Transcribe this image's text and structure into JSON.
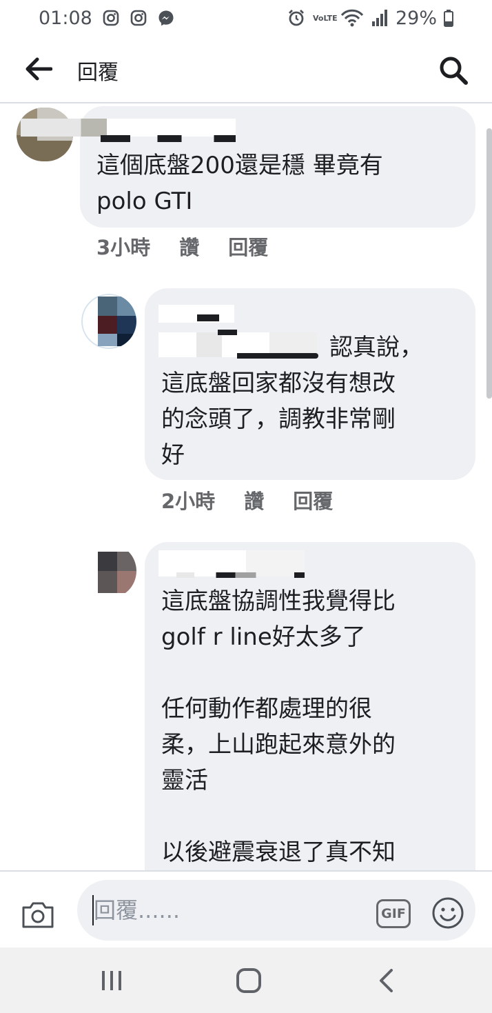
{
  "status_bar": {
    "time": "01:08",
    "network": "VoLTE",
    "battery": "29%"
  },
  "header": {
    "title": "回覆",
    "back_icon": "arrow-left-icon",
    "search_icon": "search-icon"
  },
  "comments": [
    {
      "text": "這個底盤200還是穩 畢竟有\npolo GTI",
      "time": "3小時",
      "like": "讚",
      "reply": "回覆"
    },
    {
      "text_suffix": "認真說，",
      "text": "這底盤回家都沒有想改\n的念頭了，調教非常剛\n好",
      "time": "2小時",
      "like": "讚",
      "reply": "回覆"
    },
    {
      "text": "這底盤協調性我覺得比\ngolf r line好太多了\n\n任何動作都處理的很\n柔，上山跑起來意外的\n靈活\n\n以後避震衰退了真不知"
    }
  ],
  "composer": {
    "placeholder": "回覆......",
    "gif_label": "GIF",
    "camera_icon": "camera-icon",
    "emoji_icon": "emoji-icon"
  },
  "nav": {
    "recents_icon": "recents-icon",
    "home_icon": "home-icon",
    "back_icon": "back-chevron-icon"
  },
  "colors": {
    "bubble": "#eff0f3",
    "meta_text": "#65676b",
    "primary_text": "#1c1e21"
  }
}
